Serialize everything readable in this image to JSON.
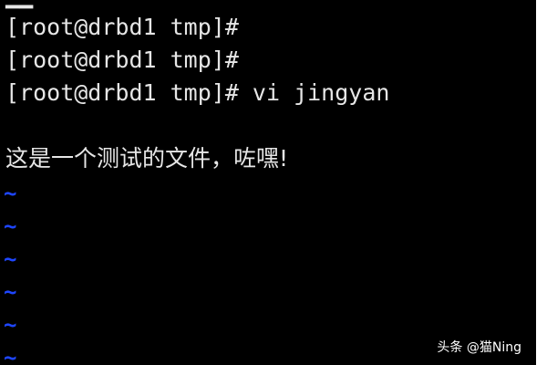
{
  "terminal": {
    "lines": [
      "[root@drbd1 tmp]#",
      "[root@drbd1 tmp]#",
      "[root@drbd1 tmp]# vi jingyan"
    ],
    "file_content": "这是一个测试的文件，咗嘿!",
    "empty_line_marker": "~",
    "colors": {
      "background": "#000000",
      "text": "#e6e6e6",
      "tilde": "#1e46ff"
    }
  },
  "watermark": {
    "text": "头条 @猫Ning"
  }
}
